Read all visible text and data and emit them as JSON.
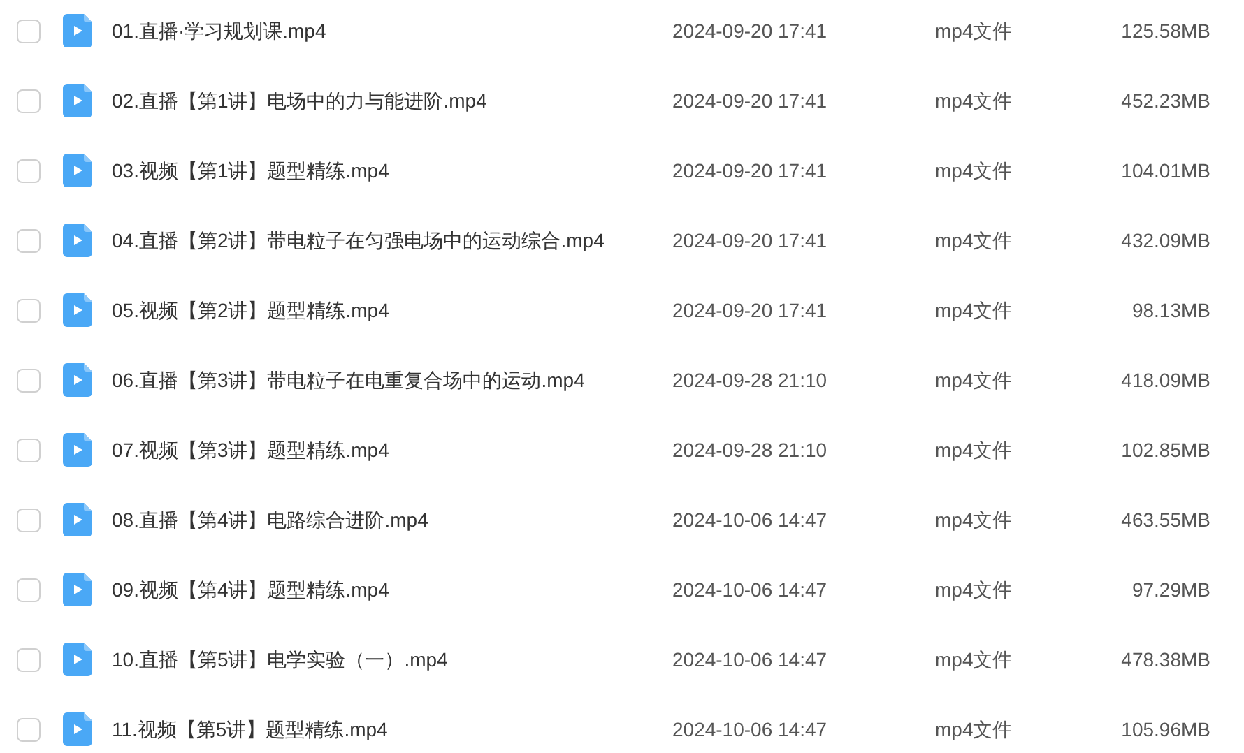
{
  "files": [
    {
      "checked": false,
      "name": "01.直播·学习规划课.mp4",
      "modified": "2024-09-20 17:41",
      "type": "mp4文件",
      "size": "125.58MB"
    },
    {
      "checked": false,
      "name": "02.直播【第1讲】电场中的力与能进阶.mp4",
      "modified": "2024-09-20 17:41",
      "type": "mp4文件",
      "size": "452.23MB"
    },
    {
      "checked": false,
      "name": "03.视频【第1讲】题型精练.mp4",
      "modified": "2024-09-20 17:41",
      "type": "mp4文件",
      "size": "104.01MB"
    },
    {
      "checked": false,
      "name": "04.直播【第2讲】带电粒子在匀强电场中的运动综合.mp4",
      "modified": "2024-09-20 17:41",
      "type": "mp4文件",
      "size": "432.09MB"
    },
    {
      "checked": false,
      "name": "05.视频【第2讲】题型精练.mp4",
      "modified": "2024-09-20 17:41",
      "type": "mp4文件",
      "size": "98.13MB"
    },
    {
      "checked": false,
      "name": "06.直播【第3讲】带电粒子在电重复合场中的运动.mp4",
      "modified": "2024-09-28 21:10",
      "type": "mp4文件",
      "size": "418.09MB"
    },
    {
      "checked": false,
      "name": "07.视频【第3讲】题型精练.mp4",
      "modified": "2024-09-28 21:10",
      "type": "mp4文件",
      "size": "102.85MB"
    },
    {
      "checked": false,
      "name": "08.直播【第4讲】电路综合进阶.mp4",
      "modified": "2024-10-06 14:47",
      "type": "mp4文件",
      "size": "463.55MB"
    },
    {
      "checked": false,
      "name": "09.视频【第4讲】题型精练.mp4",
      "modified": "2024-10-06 14:47",
      "type": "mp4文件",
      "size": "97.29MB"
    },
    {
      "checked": false,
      "name": "10.直播【第5讲】电学实验（一）.mp4",
      "modified": "2024-10-06 14:47",
      "type": "mp4文件",
      "size": "478.38MB"
    },
    {
      "checked": false,
      "name": "11.视频【第5讲】题型精练.mp4",
      "modified": "2024-10-06 14:47",
      "type": "mp4文件",
      "size": "105.96MB"
    }
  ]
}
